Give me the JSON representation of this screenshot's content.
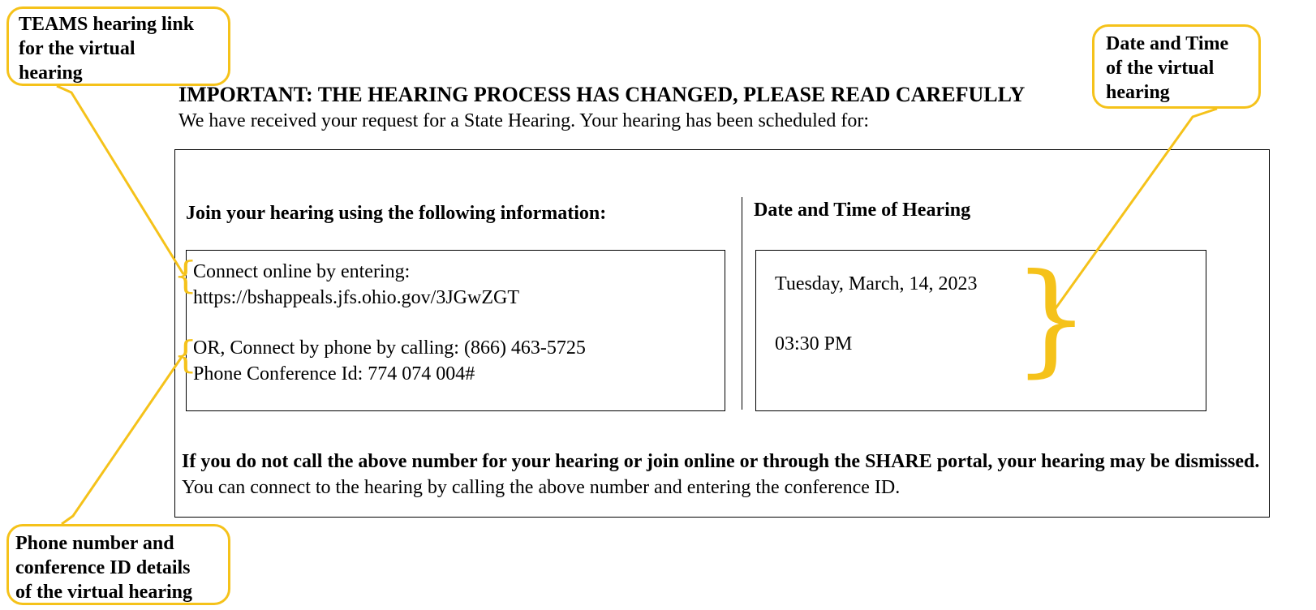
{
  "callouts": {
    "teams": [
      "TEAMS hearing link",
      "for the virtual",
      "hearing"
    ],
    "datetime": [
      "Date and Time",
      "of the virtual",
      "hearing"
    ],
    "phone": [
      "Phone number and",
      "conference ID details",
      "of the virtual hearing"
    ]
  },
  "notice": {
    "heading": "IMPORTANT: THE HEARING PROCESS HAS CHANGED, PLEASE READ CAREFULLY",
    "intro": "We have received your request for a State Hearing. Your hearing has been scheduled for:",
    "join_heading": "Join your hearing using the following information:",
    "date_time_heading": "Date and Time of Hearing",
    "online_label": "Connect online by entering:",
    "online_url": "https://bshappeals.jfs.ohio.gov/3JGwZGT",
    "phone_line": "OR, Connect by phone by calling: (866) 463-5725",
    "conference_line": "Phone Conference Id: 774 074 004#",
    "hearing_date": "Tuesday, March, 14, 2023",
    "hearing_time": "03:30 PM",
    "warning_bold": "If you do not call the above number for your hearing or join online or through the SHARE portal, your hearing may be dismissed.",
    "warning_rest": " You can connect to the hearing by calling the above number and entering the conference ID."
  },
  "colors": {
    "callout_accent": "#f5c21a",
    "text": "#000000",
    "background": "#ffffff"
  }
}
